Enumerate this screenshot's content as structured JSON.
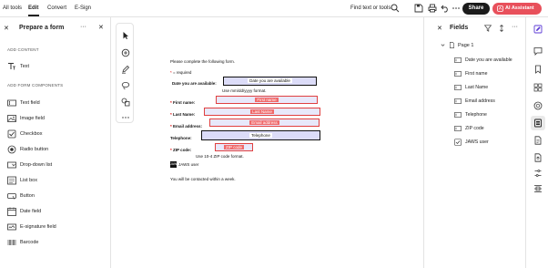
{
  "topbar": {
    "menu": [
      "All tools",
      "Edit",
      "Convert",
      "E-Sign"
    ],
    "active": "Edit",
    "find_label": "Find text or tools",
    "share_label": "Share",
    "ai_label": "AI Assistant",
    "icons": [
      "search-icon",
      "save-icon",
      "print-icon",
      "undo-icon",
      "more-icon"
    ]
  },
  "left_panel": {
    "title": "Prepare a form",
    "section_add_content": "ADD CONTENT",
    "add_content_items": [
      {
        "label": "Text",
        "icon": "text-icon"
      }
    ],
    "section_components": "ADD FORM COMPONENTS",
    "components": [
      {
        "label": "Text field",
        "icon": "text-field-icon"
      },
      {
        "label": "Image field",
        "icon": "image-field-icon"
      },
      {
        "label": "Checkbox",
        "icon": "checkbox-icon"
      },
      {
        "label": "Radio button",
        "icon": "radio-button-icon"
      },
      {
        "label": "Drop-down list",
        "icon": "dropdown-list-icon"
      },
      {
        "label": "List box",
        "icon": "list-box-icon"
      },
      {
        "label": "Button",
        "icon": "button-icon"
      },
      {
        "label": "Date field",
        "icon": "date-field-icon"
      },
      {
        "label": "E-signature field",
        "icon": "esignature-field-icon"
      },
      {
        "label": "Barcode",
        "icon": "barcode-icon"
      }
    ]
  },
  "doc": {
    "intro": "Please complete the following form.",
    "required_star": "*",
    "required_note": " = required",
    "date_label": "Date you are available:",
    "date_field": "Date you are available",
    "date_hint": "Use mm/dd/yyyy format.",
    "first_name_label": "First name:",
    "first_name_field": "First name",
    "last_name_label": "Last Name:",
    "last_name_field": "Last Name",
    "email_label": "Email address:",
    "email_field": "Email address",
    "telephone_label": "Telephone:",
    "telephone_field": "Telephone",
    "zip_label": "ZIP code:",
    "zip_field": "ZIP code",
    "zip_hint": "Use 10-4 ZIP code format.",
    "jaws_badge": "JAWS",
    "jaws_label": "JAWS user",
    "closing": "You will be contacted within a week."
  },
  "right_panel": {
    "title": "Fields",
    "page_label": "Page 1",
    "fields": [
      "Date you are available",
      "First name",
      "Last Name",
      "Email address",
      "Telephone",
      "ZIP code",
      "JAWS user"
    ]
  },
  "colors": {
    "ai_button": "#e8505b",
    "share_button": "#1b1b1b",
    "field_fill": "#dcdcf8",
    "field_error": "#f06a6a",
    "rail_accent": "#5c3bd6"
  }
}
